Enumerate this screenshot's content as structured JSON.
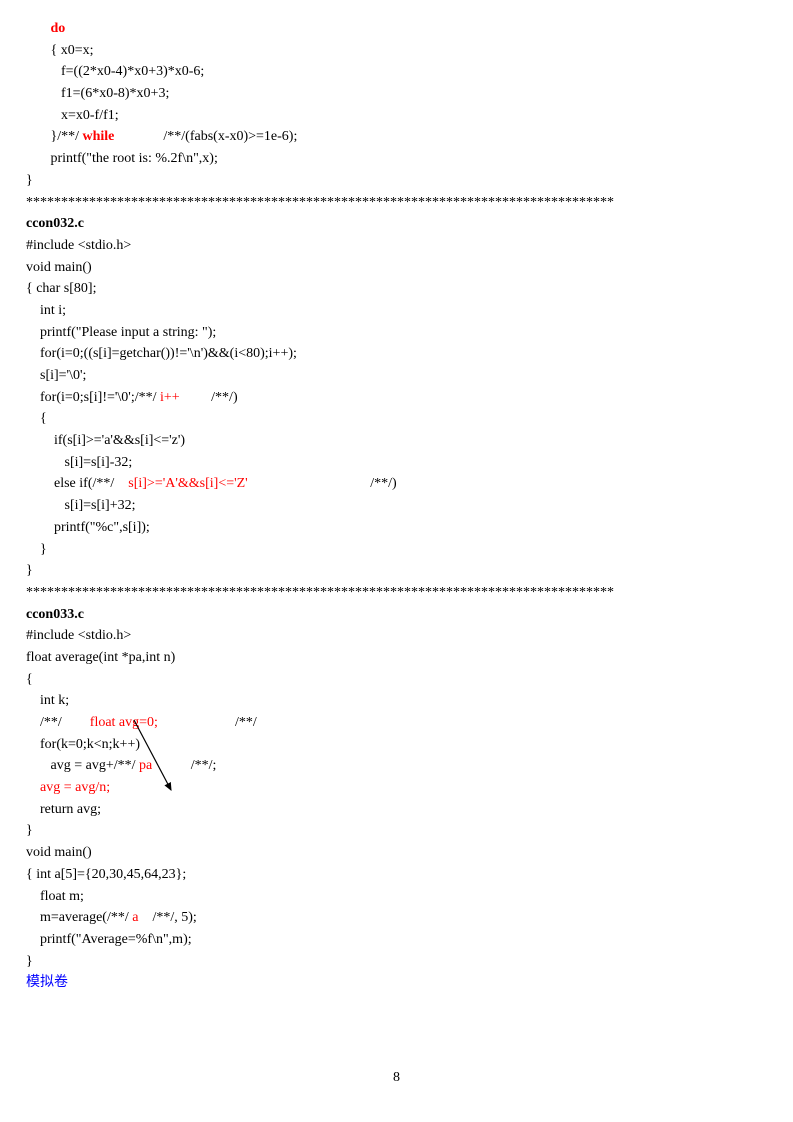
{
  "sec1": {
    "l1": "       do",
    "l2": "       { x0=x;",
    "l3": "          f=((2*x0-4)*x0+3)*x0-6;",
    "l4": "          f1=(6*x0-8)*x0+3;",
    "l5": "          x=x0-f/f1;",
    "l6a": "       }/**/ ",
    "l6b": "while",
    "l6c": "              /**/(fabs(x-x0)>=1e-6);",
    "l7": "       printf(\"the root is: %.2f\\n\",x);",
    "l8": "}"
  },
  "stars1": "************************************************************************************",
  "title1": "ccon032.c",
  "sec2": {
    "l1": "#include <stdio.h>",
    "l2": "void main()",
    "l3": "{ char s[80];",
    "l4": "    int i;",
    "l5": "    printf(\"Please input a string: \");",
    "l6": "    for(i=0;((s[i]=getchar())!='\\n')&&(i<80);i++);",
    "l7": "    s[i]='\\0';",
    "l8a": "    for(i=0;s[i]!='\\0';/**/ ",
    "l8b": "i++",
    "l8c": "         /**/)",
    "l9": "    {",
    "l10": "        if(s[i]>='a'&&s[i]<='z')",
    "l11": "           s[i]=s[i]-32;",
    "l12a": "        else if(/**/    ",
    "l12b": "s[i]>='A'&&s[i]<='Z'",
    "l12c": "                                   /**/)",
    "l13": "           s[i]=s[i]+32;",
    "l14": "        printf(\"%c\",s[i]);",
    "l15": "    }",
    "l16": "}"
  },
  "stars2": "************************************************************************************",
  "title2": "ccon033.c",
  "sec3": {
    "l1": "#include <stdio.h>",
    "l2": "float average(int *pa,int n)",
    "l3": "{",
    "l4": "    int k;",
    "l5a": "    /**/        ",
    "l5b": "float avg=0;",
    "l5c": "                      /**/",
    "l6": "    for(k=0;k<n;k++)",
    "l7a": "       avg = avg+/**/ ",
    "l7b": "pa",
    "l7c": "           /**/;",
    "l8": "    avg = avg/n;",
    "l9": "    return avg;",
    "l10": "}",
    "l11": "void main()",
    "l12": "{ int a[5]={20,30,45,64,23};",
    "l13": "    float m;",
    "l14a": "    m=average(/**/ ",
    "l14b": "a",
    "l14c": "    /**/, 5);",
    "l15": "    printf(\"Average=%f\\n\",m);",
    "l16": "}"
  },
  "footer": "模拟卷",
  "pagenum": "8"
}
